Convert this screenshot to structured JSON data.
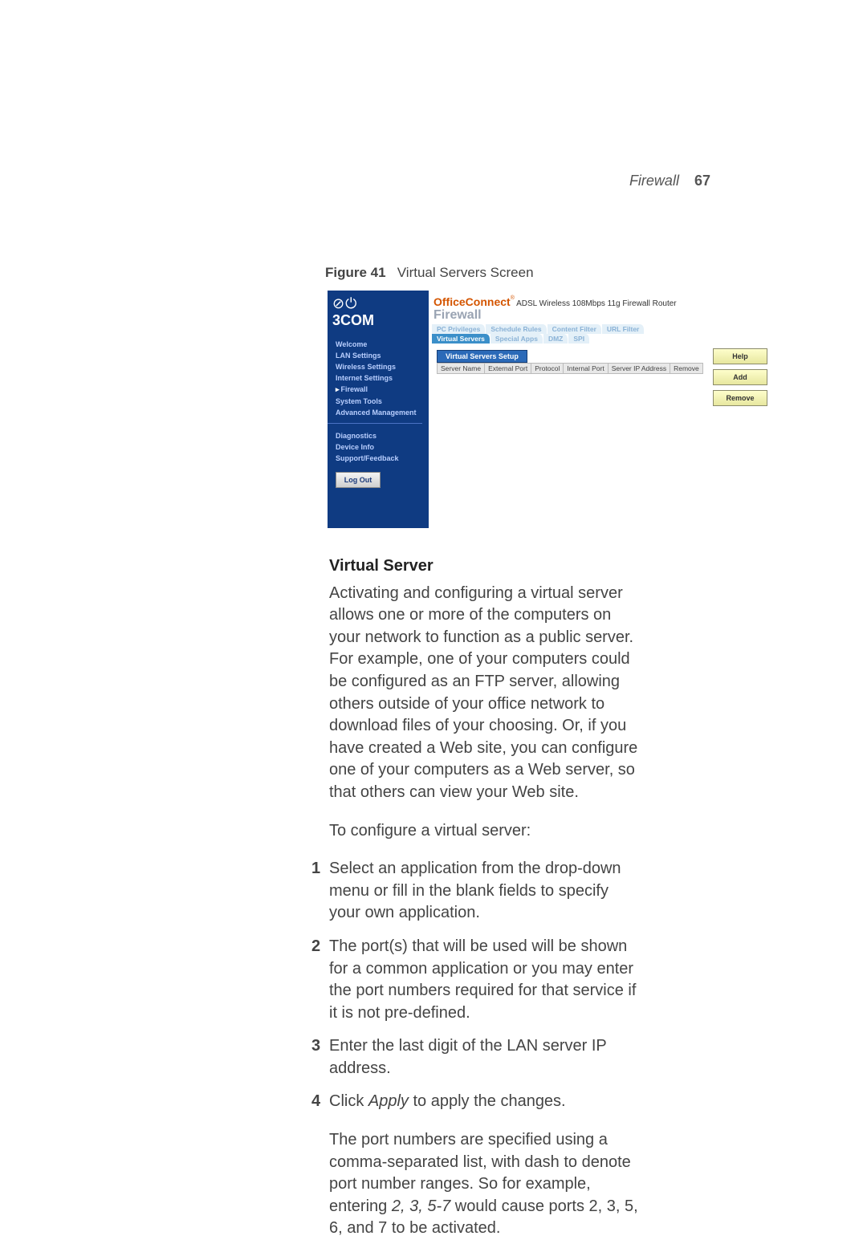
{
  "header": {
    "section": "Firewall",
    "page_number": "67"
  },
  "figure": {
    "label": "Figure 41",
    "caption": "Virtual Servers Screen"
  },
  "shot": {
    "brand": "OfficeConnect",
    "reg": "®",
    "tagline": "ADSL Wireless 108Mbps 11g Firewall Router",
    "logo_icon": "⊘ ⏻",
    "logo_text": "3COM",
    "breadcrumb": "Firewall",
    "nav": {
      "items": [
        {
          "label": "Welcome"
        },
        {
          "label": "LAN Settings"
        },
        {
          "label": "Wireless Settings"
        },
        {
          "label": "Internet Settings"
        },
        {
          "label": "Firewall",
          "active": true
        },
        {
          "label": "System Tools"
        },
        {
          "label": "Advanced Management"
        }
      ],
      "secondary": [
        {
          "label": "Diagnostics"
        },
        {
          "label": "Device Info"
        },
        {
          "label": "Support/Feedback"
        }
      ],
      "logout": "Log Out"
    },
    "tabs_row1": [
      {
        "label": "PC Privileges"
      },
      {
        "label": "Schedule Rules"
      },
      {
        "label": "Content Filter"
      },
      {
        "label": "URL Filter"
      }
    ],
    "tabs_row2": [
      {
        "label": "Virtual Servers",
        "active": true
      },
      {
        "label": "Special Apps"
      },
      {
        "label": "DMZ"
      },
      {
        "label": "SPI"
      }
    ],
    "panel_title": "Virtual Servers Setup",
    "columns": [
      "Server Name",
      "External Port",
      "Protocol",
      "Internal Port",
      "Server IP Address",
      "Remove"
    ],
    "buttons": {
      "help": "Help",
      "add": "Add",
      "remove": "Remove"
    }
  },
  "body": {
    "heading": "Virtual Server",
    "para1": "Activating and configuring a virtual server allows one or more of the computers on your network to function as a public server. For example, one of your computers could be configured as an FTP server, allowing others outside of your office network to download files of your choosing. Or, if you have created a Web site, you can configure one of your computers as a Web server, so that others can view your Web site.",
    "para2": "To configure a virtual server:",
    "steps": [
      "Select an application from the drop-down menu or fill in the blank fields to specify your own application.",
      "The port(s) that will be used will be shown for a common application or you may enter the port numbers required for that service if it is not pre-defined.",
      "Enter the last digit of the LAN server IP address.",
      {
        "pre": "Click ",
        "em": "Apply",
        "post": " to apply the changes."
      }
    ],
    "para3_pre": "The port numbers are specified using a comma-separated list, with dash to denote port number ranges. So for example, entering ",
    "para3_em": "2, 3, 5-7",
    "para3_post": " would cause ports 2, 3, 5, 6, and 7 to be activated."
  }
}
